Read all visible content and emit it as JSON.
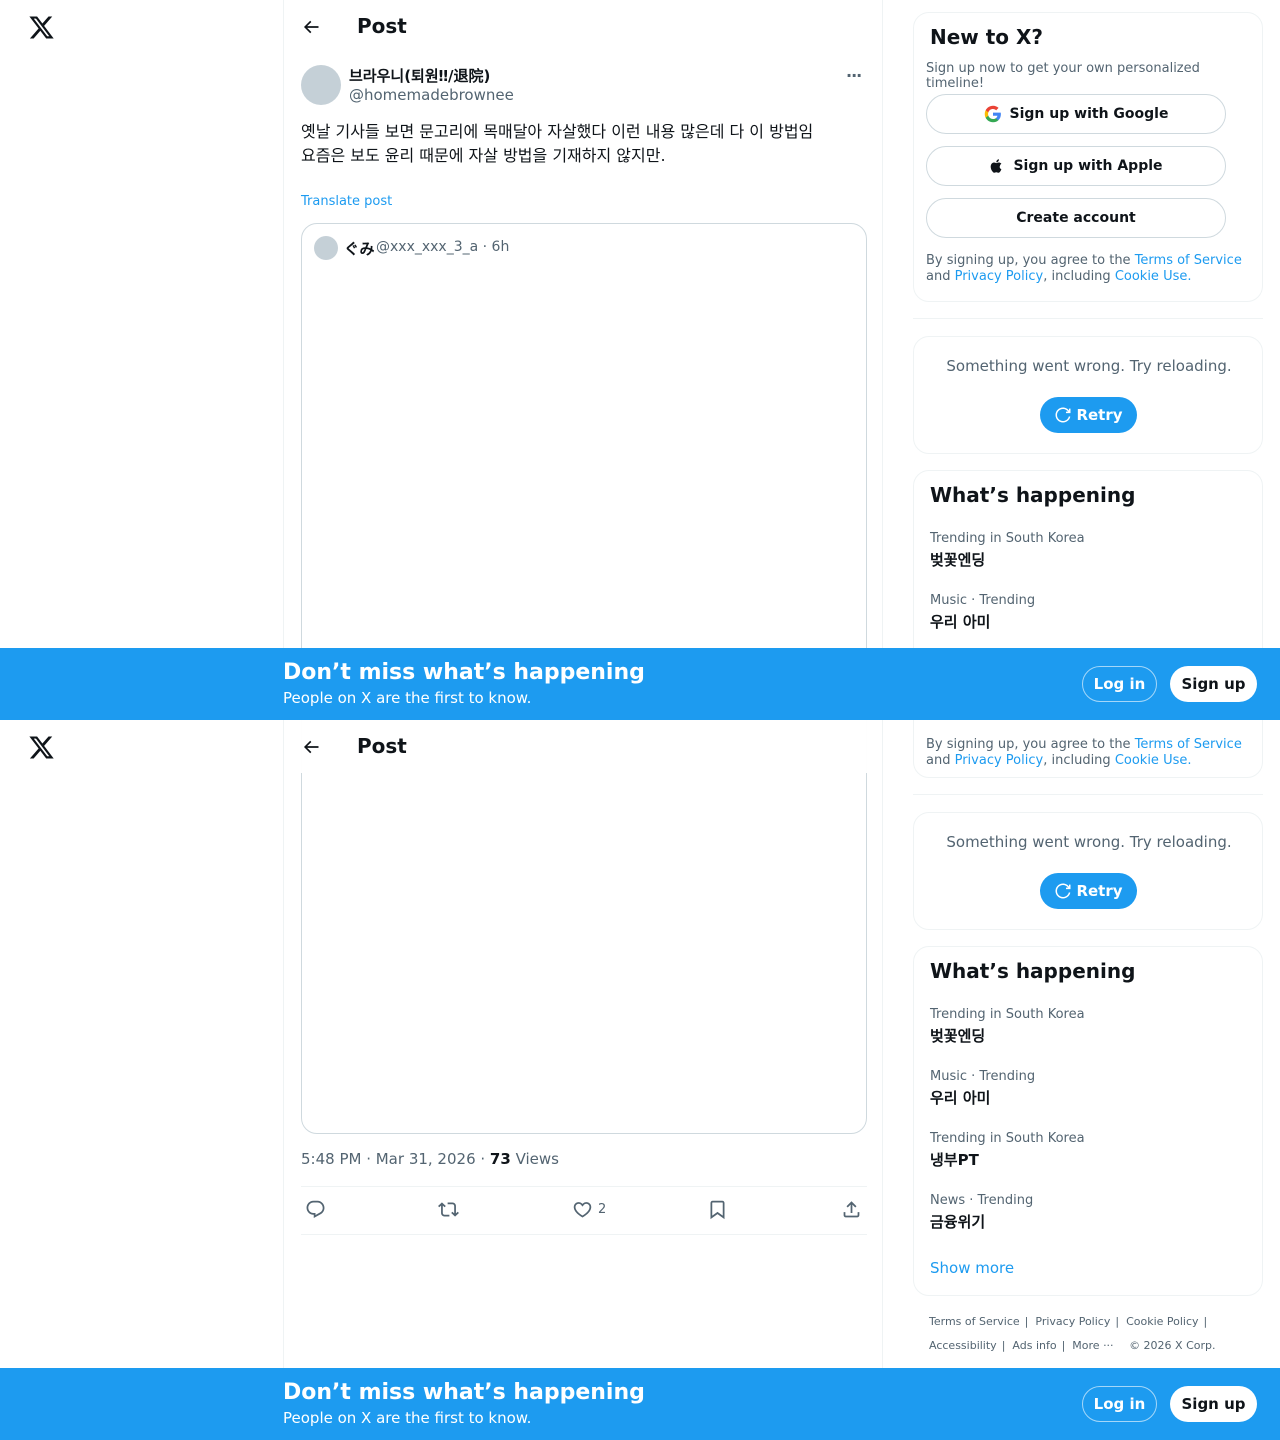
{
  "colors": {
    "accent": "#1d9bf0",
    "text": "#0f1419",
    "muted": "#536471"
  },
  "header": {
    "title": "Post"
  },
  "post": {
    "author_name": "브라우니(퇴원‼/退院)",
    "author_handle": "@homemadebrownee",
    "text_line1": "옛날 기사들 보면 문고리에 목매달아 자살했다 이런 내용 많은데 다 이 방법임",
    "text_line2": "요즘은 보도 윤리 때문에 자살 방법을 기재하지 않지만.",
    "translate_label": "Translate post",
    "timestamp": "5:48 PM · Mar 31, 2026 · ",
    "views_count": "73",
    "views_label": " Views",
    "likes": "2"
  },
  "quote": {
    "name": "ぐみ",
    "meta": "@xxx_xxx_3_a · 6h"
  },
  "signup_card": {
    "title": "New to X?",
    "subtitle": "Sign up now to get your own personalized timeline!",
    "google_label": "Sign up with Google",
    "apple_label": "Sign up with Apple",
    "create_label": "Create account",
    "legal_prefix": "By signing up, you agree to the ",
    "terms_link": "Terms of Service",
    "legal_and": " and ",
    "privacy_link": "Privacy Policy",
    "legal_including": ", including ",
    "cookie_link": "Cookie Use."
  },
  "error_card": {
    "message": "Something went wrong. Try reloading.",
    "retry_label": "Retry"
  },
  "trends": {
    "title": "What’s happening",
    "items": [
      {
        "context": "Trending in South Korea",
        "name": "벚꽃엔딩"
      },
      {
        "context": "Music · Trending",
        "name": "우리 아미"
      },
      {
        "context": "Trending in South Korea",
        "name": "냉부PT"
      },
      {
        "context": "News · Trending",
        "name": "금융위기"
      }
    ],
    "show_more": "Show more"
  },
  "footer": {
    "terms": "Terms of Service",
    "privacy": "Privacy Policy",
    "cookie": "Cookie Policy",
    "accessibility": "Accessibility",
    "ads": "Ads info",
    "more": "More ···",
    "copyright": "© 2026 X Corp."
  },
  "banner": {
    "title": "Don’t miss what’s happening",
    "subtitle": "People on X are the first to know.",
    "login_label": "Log in",
    "signup_label": "Sign up"
  }
}
